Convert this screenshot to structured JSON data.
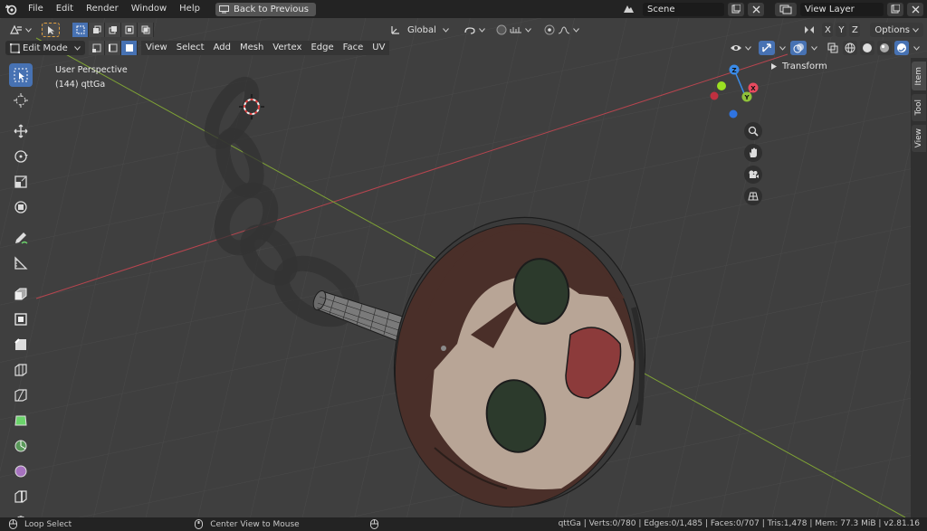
{
  "topbar": {
    "menus": [
      "File",
      "Edit",
      "Render",
      "Window",
      "Help"
    ],
    "back_button": "Back to Previous",
    "scene": "Scene",
    "view_layer": "View Layer"
  },
  "header": {
    "mode": "Edit Mode",
    "menus": [
      "View",
      "Select",
      "Add",
      "Mesh",
      "Vertex",
      "Edge",
      "Face",
      "UV"
    ],
    "orientation": "Global",
    "options": "Options",
    "axes": [
      "X",
      "Y",
      "Z"
    ]
  },
  "viewport": {
    "view_name": "User Perspective",
    "object_info": "(144) qttGa",
    "gizmo_axes": [
      "Z",
      "X",
      "Y"
    ]
  },
  "npanel": {
    "tabs": [
      "Item",
      "Tool",
      "View"
    ],
    "section": "Transform"
  },
  "status": {
    "left_action": "Loop Select",
    "middle_action": "Center View to Mouse",
    "stats": "qttGa | Verts:0/780 | Edges:0/1,485 | Faces:0/707 | Tris:1,478 | Mem: 77.3 MiB | v2.81.16"
  },
  "colors": {
    "accent": "#4772b3",
    "axis_x": "#e84a5f",
    "axis_y": "#8fc23a",
    "axis_z": "#3a8be8",
    "viewport_bg": "#3f3f3f"
  }
}
